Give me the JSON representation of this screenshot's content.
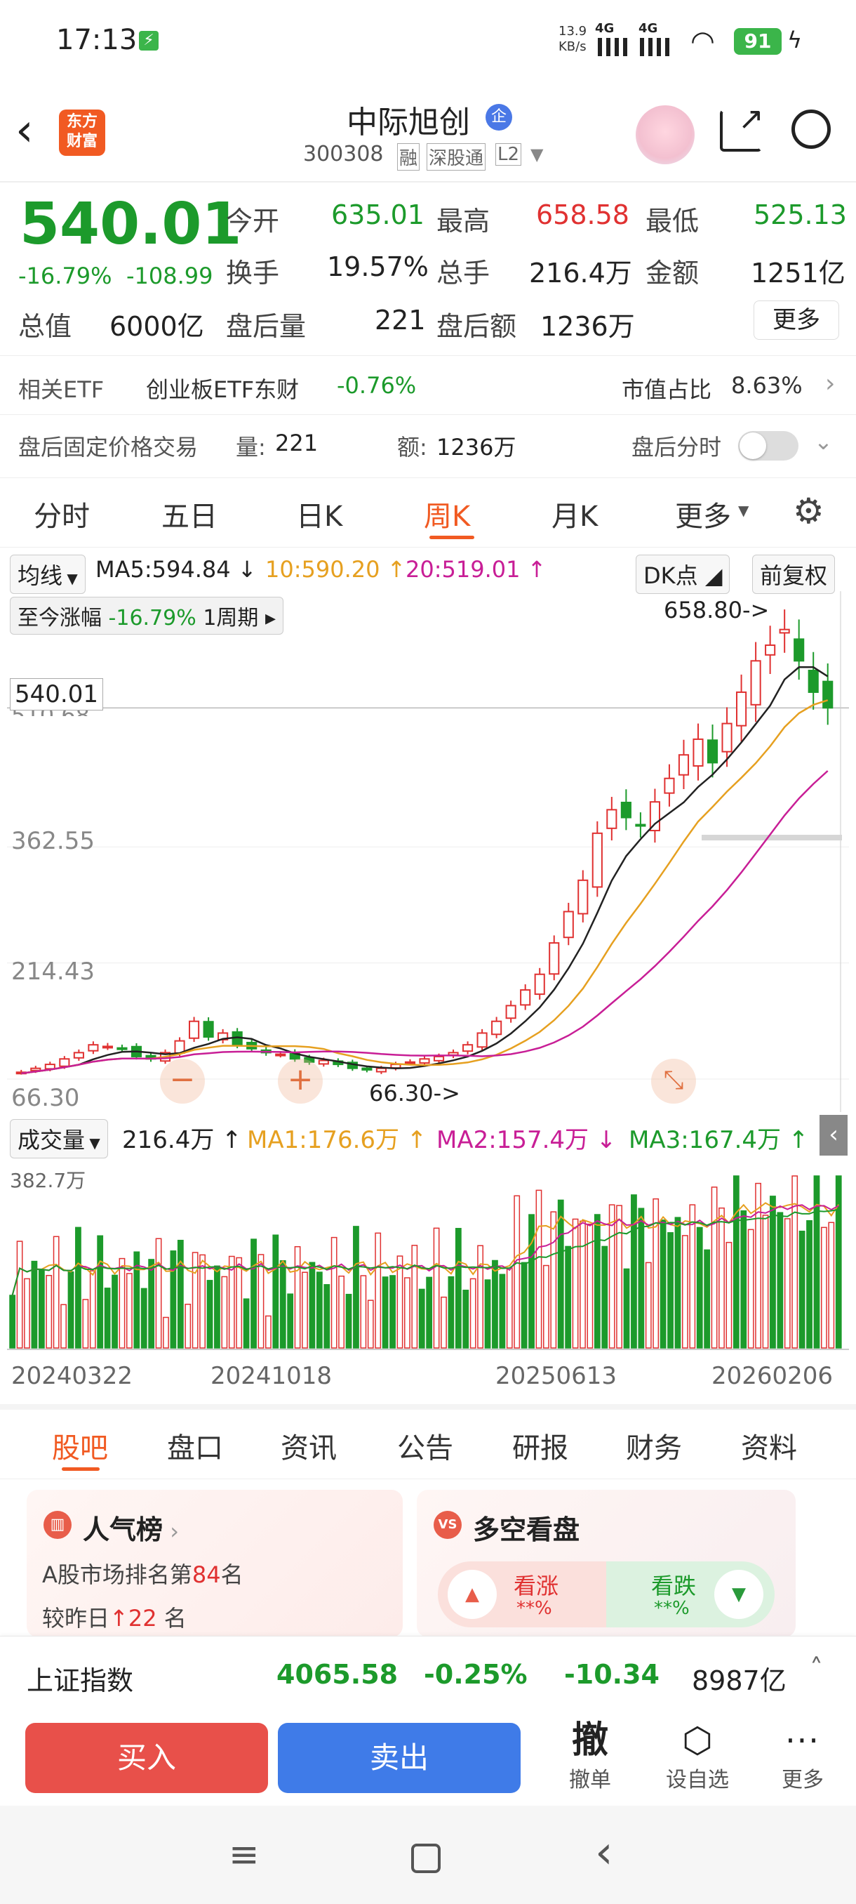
{
  "status_bar": {
    "time": "17:13",
    "net_speed": "13.9",
    "net_unit": "KB/s",
    "net1": "4G",
    "net2": "4G",
    "battery": "91"
  },
  "header": {
    "logo_line1": "东方",
    "logo_line2": "财富",
    "name": "中际旭创",
    "badge": "企",
    "code": "300308",
    "tags": [
      "融",
      "深股通",
      "L2"
    ]
  },
  "quote": {
    "price": "540.01",
    "change_pct": "-16.79%",
    "change": "-108.99",
    "open_label": "今开",
    "open": "635.01",
    "high_label": "最高",
    "high": "658.58",
    "low_label": "最低",
    "low": "525.13",
    "turnover_label": "换手",
    "turnover": "19.57%",
    "vol_label": "总手",
    "vol": "216.4万",
    "amount_label": "金额",
    "amount": "1251亿",
    "cap_label": "总值",
    "cap": "6000亿",
    "ah_vol_label": "盘后量",
    "ah_vol": "221",
    "ah_amt_label": "盘后额",
    "ah_amt": "1236万",
    "more": "更多"
  },
  "etf": {
    "label": "相关ETF",
    "name": "创业板ETF东财",
    "pct": "-0.76%",
    "ratio_label": "市值占比",
    "ratio": "8.63%"
  },
  "after": {
    "label": "盘后固定价格交易",
    "vol_label": "量:",
    "vol": "221",
    "amt_label": "额:",
    "amt": "1236万",
    "fenshi": "盘后分时"
  },
  "tabs": [
    "分时",
    "五日",
    "日K",
    "周K",
    "月K",
    "更多"
  ],
  "active_tab": "周K",
  "ma_row": {
    "sel": "均线",
    "ma5": "MA5:594.84",
    "ma10": "10:590.20",
    "ma20": "20:519.01",
    "dk": "DK点",
    "fq": "前复权"
  },
  "range_chip": {
    "label": "至今涨幅",
    "pct": "-16.79%",
    "period": "1周期"
  },
  "chart_labels": {
    "top_mark": "658.80->",
    "bottom_mark": "66.30->",
    "price_tag": "540.01",
    "y1": "362.55",
    "y2": "214.43",
    "y3": "66.30",
    "y_top_partial": "510.68"
  },
  "vol_row": {
    "sel": "成交量",
    "v": "216.4万",
    "ma1": "MA1:176.6万",
    "ma2": "MA2:157.4万",
    "ma3": "MA3:167.4万",
    "max": "382.7万"
  },
  "x_labels": [
    "20240322",
    "20241018",
    "20250613",
    "20260206"
  ],
  "bottom_tabs": [
    "股吧",
    "盘口",
    "资讯",
    "公告",
    "研报",
    "财务",
    "资料"
  ],
  "cards": {
    "pop_title": "人气榜",
    "pop_rank_prefix": "A股市场排名第",
    "pop_rank": "84",
    "pop_rank_suffix": "名",
    "pop_change_prefix": "较昨日",
    "pop_change": "22",
    "pop_change_suffix": "名",
    "ls_title": "多空看盘",
    "up": "看涨",
    "up_val": "**%",
    "down": "看跌",
    "down_val": "**%"
  },
  "index_bar": {
    "name": "上证指数",
    "value": "4065.58",
    "pct": "-0.25%",
    "chg": "-10.34",
    "amt": "8987亿"
  },
  "actions": {
    "buy": "买入",
    "sell": "卖出",
    "cancel_icon": "撤",
    "cancel": "撤单",
    "set": "设自选",
    "more": "更多"
  },
  "chart_data": {
    "type": "candlestick",
    "title": "",
    "period": "weekly",
    "x": [
      "20240322",
      "20241018",
      "20250613",
      "20260206"
    ],
    "y_ticks": [
      66.3,
      214.43,
      362.55
    ],
    "close_approx": [
      75,
      80,
      85,
      92,
      100,
      110,
      108,
      105,
      95,
      92,
      100,
      115,
      140,
      120,
      125,
      110,
      105,
      100,
      98,
      92,
      88,
      90,
      85,
      80,
      78,
      80,
      85,
      88,
      92,
      95,
      100,
      110,
      125,
      140,
      160,
      180,
      200,
      240,
      280,
      320,
      380,
      410,
      400,
      390,
      420,
      450,
      480,
      500,
      470,
      520,
      560,
      600,
      620,
      640,
      600,
      560,
      540
    ],
    "volume_max": "382.7万"
  }
}
